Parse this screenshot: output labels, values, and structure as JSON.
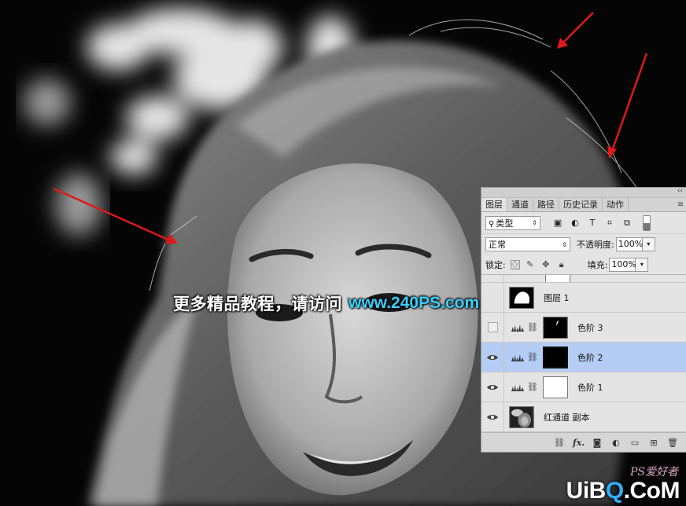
{
  "watermark": {
    "chinese": "更多精品教程，请访问",
    "url": "www.240PS.com"
  },
  "panel": {
    "tabs": [
      {
        "label": "图层",
        "active": true
      },
      {
        "label": "通道",
        "active": false
      },
      {
        "label": "路径",
        "active": false
      },
      {
        "label": "历史记录",
        "active": false
      },
      {
        "label": "动作",
        "active": false
      }
    ],
    "filter": {
      "kind": "类型",
      "search_icon": "search-icon"
    },
    "blend_mode": "正常",
    "opacity_label": "不透明度:",
    "opacity_value": "100%",
    "lock_label": "锁定:",
    "fill_label": "填充:",
    "fill_value": "100%",
    "layers": [
      {
        "name": "图层 1",
        "visible": false,
        "type": "pixel"
      },
      {
        "name": "色阶 3",
        "visible": false,
        "type": "adjustment"
      },
      {
        "name": "色阶 2",
        "visible": true,
        "type": "adjustment",
        "selected": true
      },
      {
        "name": "色阶 1",
        "visible": true,
        "type": "adjustment"
      },
      {
        "name": "红通道 副本",
        "visible": true,
        "type": "pixel"
      }
    ],
    "footer_icons": [
      "link-icon",
      "fx-icon",
      "mask-icon",
      "adjustment-icon",
      "folder-icon",
      "new-layer-icon",
      "trash-icon"
    ]
  },
  "logo": {
    "mark": "PS爱好者",
    "text_part1": "UiB",
    "text_q": "Q",
    "text_part2": ".CoM"
  },
  "colors": {
    "selected_layer": "#b5cdf5",
    "arrow": "#e0191a",
    "url_text": "#3bd0ff"
  }
}
